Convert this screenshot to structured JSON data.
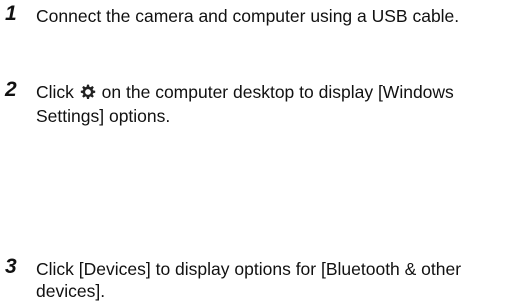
{
  "steps": [
    {
      "number": "1",
      "text": "Connect the camera and computer using a USB cable."
    },
    {
      "number": "2",
      "text_before_icon": "Click",
      "icon": "gear-icon",
      "text_after_icon": "on the computer desktop to display [Windows Settings] options."
    },
    {
      "number": "3",
      "text": "Click [Devices] to display options for [Bluetooth & other devices]."
    }
  ]
}
